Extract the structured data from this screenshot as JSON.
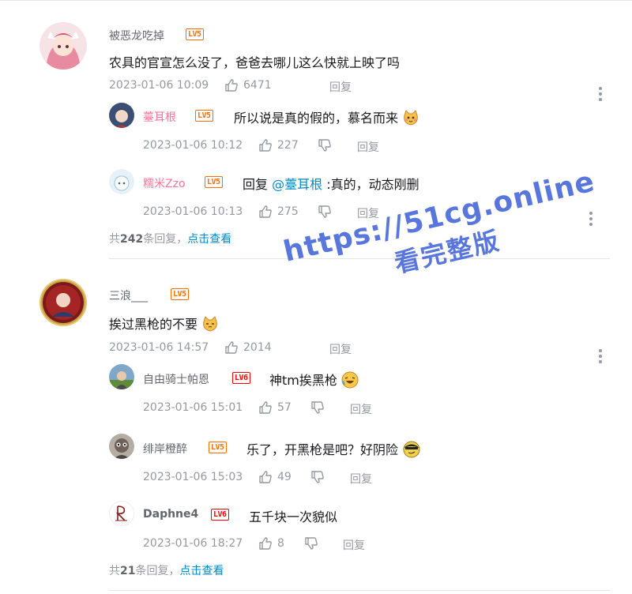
{
  "comments": [
    {
      "username": "被恶龙吃掉",
      "level": "LV5",
      "content": "农具的官宣怎么没了，爸爸去哪儿这么快就上映了吗",
      "time": "2023-01-06 10:09",
      "likes": "6471",
      "reply_label": "回复",
      "replies": [
        {
          "username": "薹耳根",
          "level": "LV5",
          "content": "所以说是真的假的，慕名而来",
          "time": "2023-01-06 10:12",
          "likes": "227",
          "reply_label": "回复"
        },
        {
          "username": "糯米Zzo",
          "level": "LV5",
          "content_prefix": "回复 ",
          "mention": "@薹耳根",
          "content_suffix": " :真的，动态刚删",
          "time": "2023-01-06 10:13",
          "likes": "275",
          "reply_label": "回复"
        }
      ],
      "total_prefix": "共",
      "total_count": "242",
      "total_suffix": "条回复，",
      "view_link": "点击查看"
    },
    {
      "username": "三浪___",
      "level": "LV5",
      "content": "挨过黑枪的不要",
      "time": "2023-01-06 14:57",
      "likes": "2014",
      "reply_label": "回复",
      "replies": [
        {
          "username": "自由骑士帕恩",
          "level": "LV6",
          "content": "神tm挨黑枪",
          "time": "2023-01-06 15:01",
          "likes": "57",
          "reply_label": "回复"
        },
        {
          "username": "绯岸橙醉",
          "level": "LV5",
          "content": "乐了，开黑枪是吧？好阴险",
          "time": "2023-01-06 15:03",
          "likes": "49",
          "reply_label": "回复"
        },
        {
          "username": "Daphne4",
          "level": "LV6",
          "content": "五千块一次貌似",
          "time": "2023-01-06 18:27",
          "likes": "8",
          "reply_label": "回复"
        }
      ],
      "total_prefix": "共",
      "total_count": "21",
      "total_suffix": "条回复，",
      "view_link": "点击查看"
    }
  ],
  "watermark": {
    "line1": "https://51cg.online",
    "line2": "看完整版"
  },
  "colors": {
    "link": "#008ac5",
    "pink_name": "#fb7299",
    "meta": "#9499a0",
    "level": "#ff6c00",
    "watermark": "#3d5fd6"
  }
}
